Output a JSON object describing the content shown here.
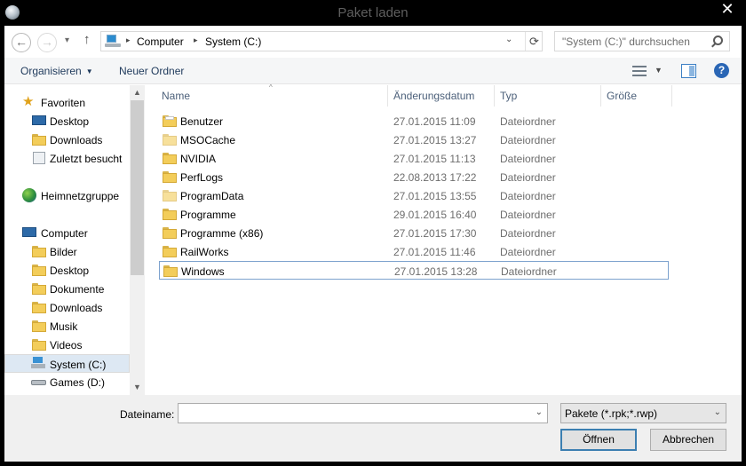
{
  "window": {
    "title": "Paket laden",
    "close_glyph": "✕"
  },
  "nav_buttons": {
    "back_glyph": "←",
    "forward_glyph": "→",
    "recent_glyph": "▾",
    "up_glyph": "↑"
  },
  "address": {
    "crumbs": [
      "Computer",
      "System (C:)"
    ],
    "separator_glyph": "▸",
    "dropdown_glyph": "⌄",
    "refresh_glyph": "⟳"
  },
  "search": {
    "placeholder": "\"System (C:)\" durchsuchen"
  },
  "toolbar": {
    "organize_label": "Organisieren",
    "organize_arrow": "▼",
    "new_folder_label": "Neuer Ordner",
    "view_dd_glyph": "▼",
    "help_glyph": "?"
  },
  "nav": {
    "favorites": "Favoriten",
    "fav_items": [
      "Desktop",
      "Downloads",
      "Zuletzt besucht"
    ],
    "homegroup": "Heimnetzgruppe",
    "computer": "Computer",
    "computer_items": [
      "Bilder",
      "Desktop",
      "Dokumente",
      "Downloads",
      "Musik",
      "Videos",
      "System (C:)",
      "Games (D:)"
    ],
    "scroll_up_glyph": "▲",
    "scroll_down_glyph": "▼"
  },
  "columns": {
    "name": "Name",
    "date": "Änderungsdatum",
    "type": "Typ",
    "size": "Größe",
    "sort_glyph": "^"
  },
  "files": [
    {
      "name": "Benutzer",
      "date": "27.01.2015 11:09",
      "type": "Dateiordner"
    },
    {
      "name": "MSOCache",
      "date": "27.01.2015 13:27",
      "type": "Dateiordner"
    },
    {
      "name": "NVIDIA",
      "date": "27.01.2015 11:13",
      "type": "Dateiordner"
    },
    {
      "name": "PerfLogs",
      "date": "22.08.2013 17:22",
      "type": "Dateiordner"
    },
    {
      "name": "ProgramData",
      "date": "27.01.2015 13:55",
      "type": "Dateiordner"
    },
    {
      "name": "Programme",
      "date": "29.01.2015 16:40",
      "type": "Dateiordner"
    },
    {
      "name": "Programme (x86)",
      "date": "27.01.2015 17:30",
      "type": "Dateiordner"
    },
    {
      "name": "RailWorks",
      "date": "27.01.2015 11:46",
      "type": "Dateiordner"
    },
    {
      "name": "Windows",
      "date": "27.01.2015 13:28",
      "type": "Dateiordner"
    }
  ],
  "bottom": {
    "filename_label": "Dateiname:",
    "filename_value": "",
    "filetype": "Pakete (*.rpk;*.rwp)",
    "dd_glyph": "⌄",
    "open_label": "Öffnen",
    "cancel_label": "Abbrechen"
  }
}
